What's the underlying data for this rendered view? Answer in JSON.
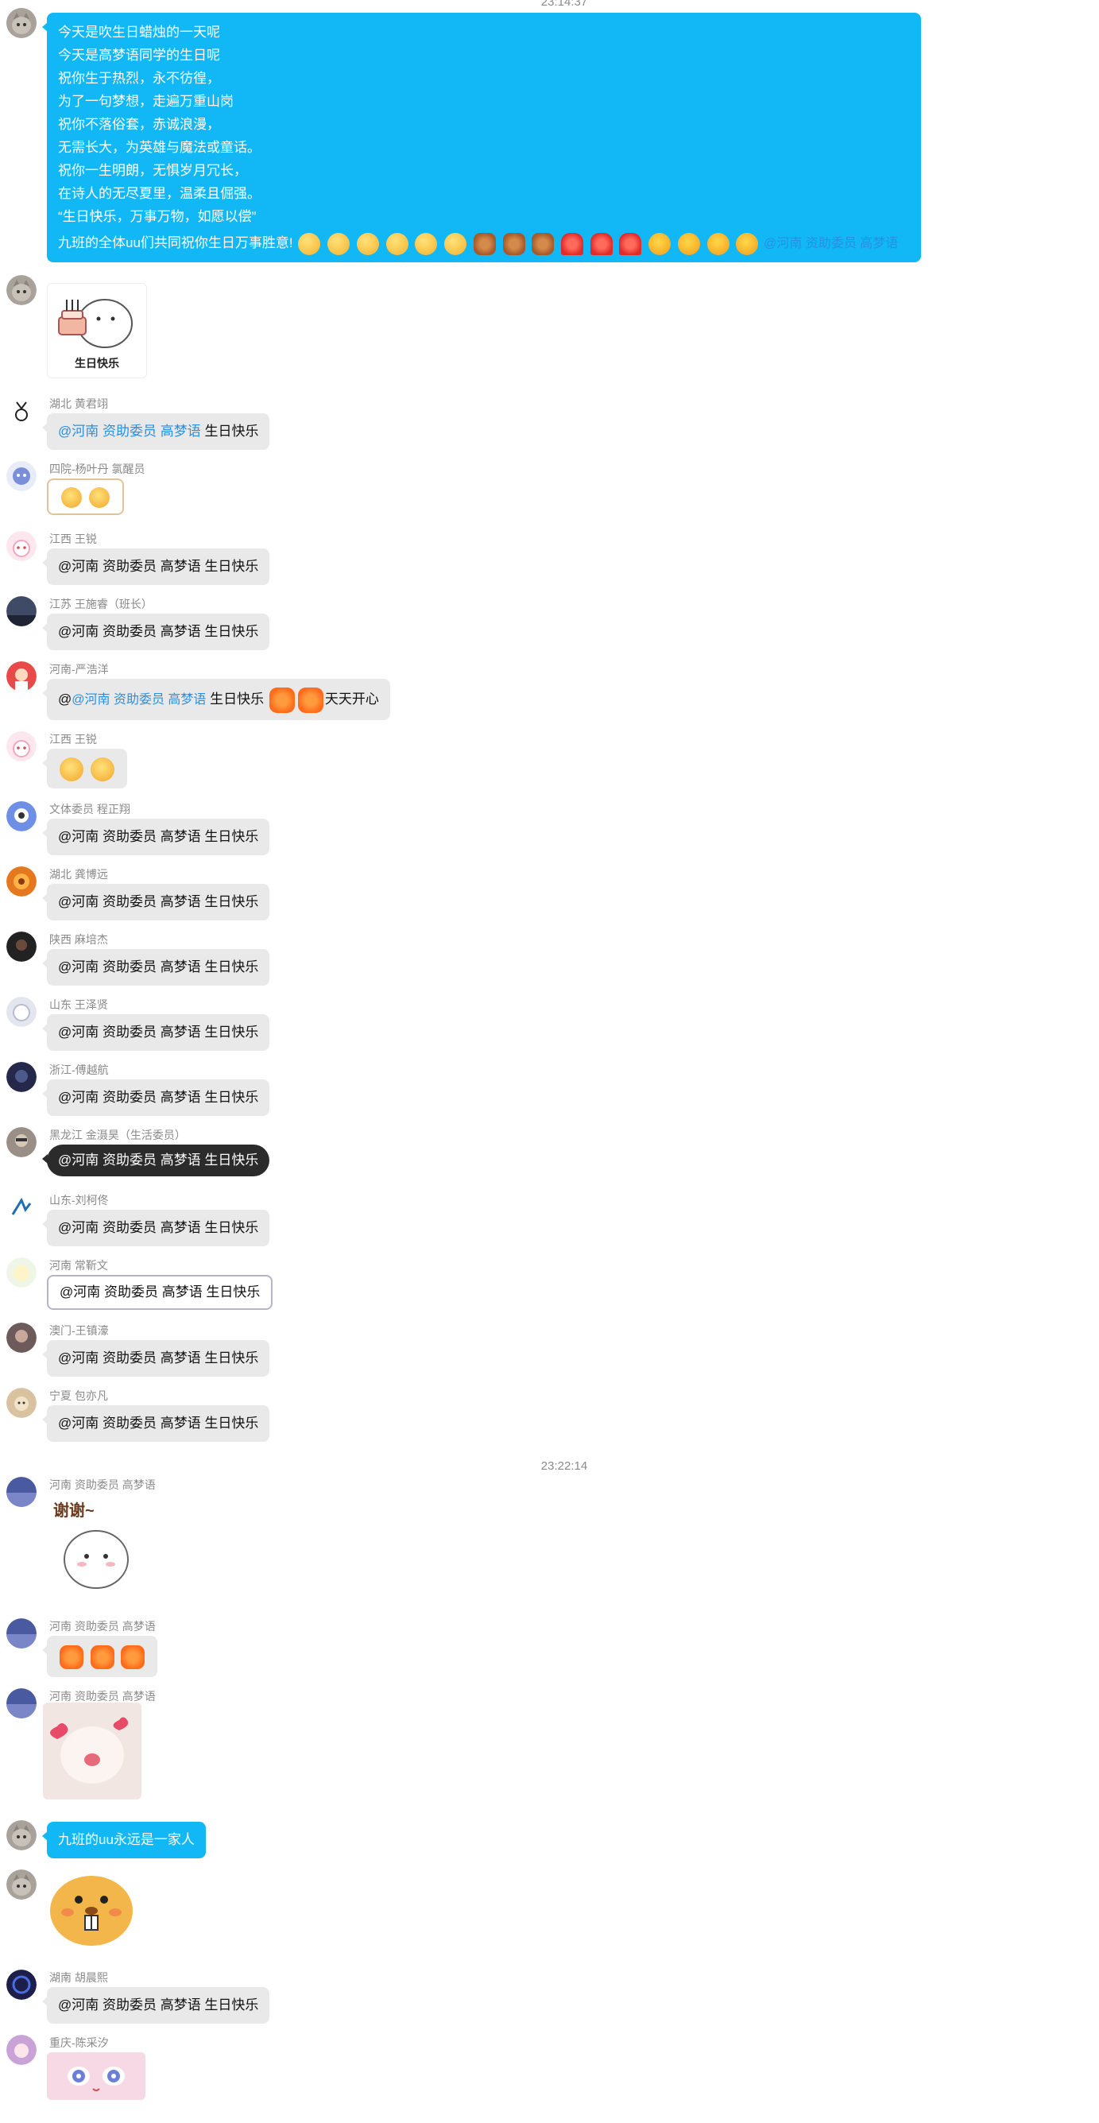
{
  "timestamps": [
    "23:14:37",
    "23:22:14"
  ],
  "mention": "@河南 资助委员 高梦语",
  "messages": [
    {
      "id": "m1",
      "sender": "",
      "type": "poem",
      "lines": [
        "今天是吹生日蜡烛的一天呢",
        "今天是高梦语同学的生日呢",
        "祝你生于热烈，永不彷徨，",
        "为了一句梦想，走遍万重山岗",
        "祝你不落俗套，赤诚浪漫，",
        "无需长大，为英雄与魔法或童话。",
        "祝你一生明朗，无惧岁月冗长，",
        "在诗人的无尽夏里，温柔且倔强。",
        "“生日快乐，万事万物，如愿以偿”"
      ],
      "last_line": "九班的全体uu们共同祝你生日万事胜意!",
      "emoji_names": [
        "party-face",
        "party-face",
        "party-face",
        "hug-face",
        "hug-face",
        "hug-face",
        "fire-flower",
        "fire-flower",
        "fire-flower",
        "red-envelope",
        "red-envelope",
        "red-envelope",
        "cheer-face",
        "cheer-face",
        "cheer-face",
        "cheer-face"
      ]
    },
    {
      "id": "m2",
      "sender": "",
      "type": "sticker",
      "sticker": "birthday-cake-sticker",
      "caption": "生日快乐"
    },
    {
      "id": "m3",
      "sender": "湖北 黄君翊",
      "type": "text",
      "text": "生日快乐"
    },
    {
      "id": "m4",
      "sender": "四院-杨叶丹 氯醒员",
      "type": "emoji",
      "emoji_names": [
        "cry-face",
        "cry-face"
      ]
    },
    {
      "id": "m5",
      "sender": "江西 王锐",
      "type": "text",
      "text": "@河南 资助委员 高梦语 生日快乐"
    },
    {
      "id": "m6",
      "sender": "江苏 王施睿（班长）",
      "type": "text",
      "text": "@河南 资助委员 高梦语 生日快乐"
    },
    {
      "id": "m7",
      "sender": "河南-严浩洋",
      "type": "mixed",
      "prefix": "@",
      "middle": "生日快乐",
      "suffix": "天天开心"
    },
    {
      "id": "m8",
      "sender": "江西 王锐",
      "type": "emoji",
      "emoji_names": [
        "tears-of-joy-face",
        "tears-of-joy-face"
      ]
    },
    {
      "id": "m9",
      "sender": "文体委员 程正翔",
      "type": "text",
      "text": "@河南 资助委员 高梦语 生日快乐"
    },
    {
      "id": "m10",
      "sender": "湖北 龚博远",
      "type": "text",
      "text": "@河南 资助委员 高梦语 生日快乐"
    },
    {
      "id": "m11",
      "sender": "陕西 麻培杰",
      "type": "text",
      "text": "@河南 资助委员 高梦语 生日快乐"
    },
    {
      "id": "m12",
      "sender": "山东 王泽贤",
      "type": "text",
      "text": "@河南 资助委员 高梦语 生日快乐"
    },
    {
      "id": "m13",
      "sender": "浙江-傅越航",
      "type": "text",
      "text": "@河南 资助委员 高梦语 生日快乐"
    },
    {
      "id": "m14",
      "sender": "黑龙江 金滠昊（生活委员）",
      "type": "text",
      "text": "@河南 资助委员 高梦语 生日快乐",
      "style": "dark"
    },
    {
      "id": "m15",
      "sender": "山东-刘柯佟",
      "type": "text",
      "text": "@河南 资助委员 高梦语 生日快乐"
    },
    {
      "id": "m16",
      "sender": "河南 常靳文",
      "type": "text",
      "text": "@河南 资助委员 高梦语 生日快乐",
      "style": "framed"
    },
    {
      "id": "m17",
      "sender": "澳门-王镇濠",
      "type": "text",
      "text": "@河南 资助委员 高梦语 生日快乐"
    },
    {
      "id": "m18",
      "sender": "宁夏 包亦凡",
      "type": "text",
      "text": "@河南 资助委员 高梦语 生日快乐"
    },
    {
      "id": "m19",
      "sender": "河南 资助委员 高梦语",
      "type": "sticker",
      "sticker": "thank-you-cat-sticker",
      "caption": "谢谢~"
    },
    {
      "id": "m20",
      "sender": "河南 资助委员 高梦语",
      "type": "emoji",
      "emoji_names": [
        "fire-flower",
        "fire-flower",
        "fire-flower"
      ]
    },
    {
      "id": "m21",
      "sender": "河南 资助委员 高梦语",
      "type": "sticker",
      "sticker": "cat-hearts-sticker"
    },
    {
      "id": "m22",
      "sender": "",
      "type": "text",
      "text": "九班的uu永远是一家人",
      "style": "blue"
    },
    {
      "id": "m23",
      "sender": "",
      "type": "sticker",
      "sticker": "beaver-face-sticker"
    },
    {
      "id": "m24",
      "sender": "湖南 胡晨熙",
      "type": "text",
      "text": "@河南 资助委员 高梦语 生日快乐"
    },
    {
      "id": "m25",
      "sender": "重庆-陈采汐",
      "type": "sticker",
      "sticker": "anime-face-sticker"
    }
  ]
}
